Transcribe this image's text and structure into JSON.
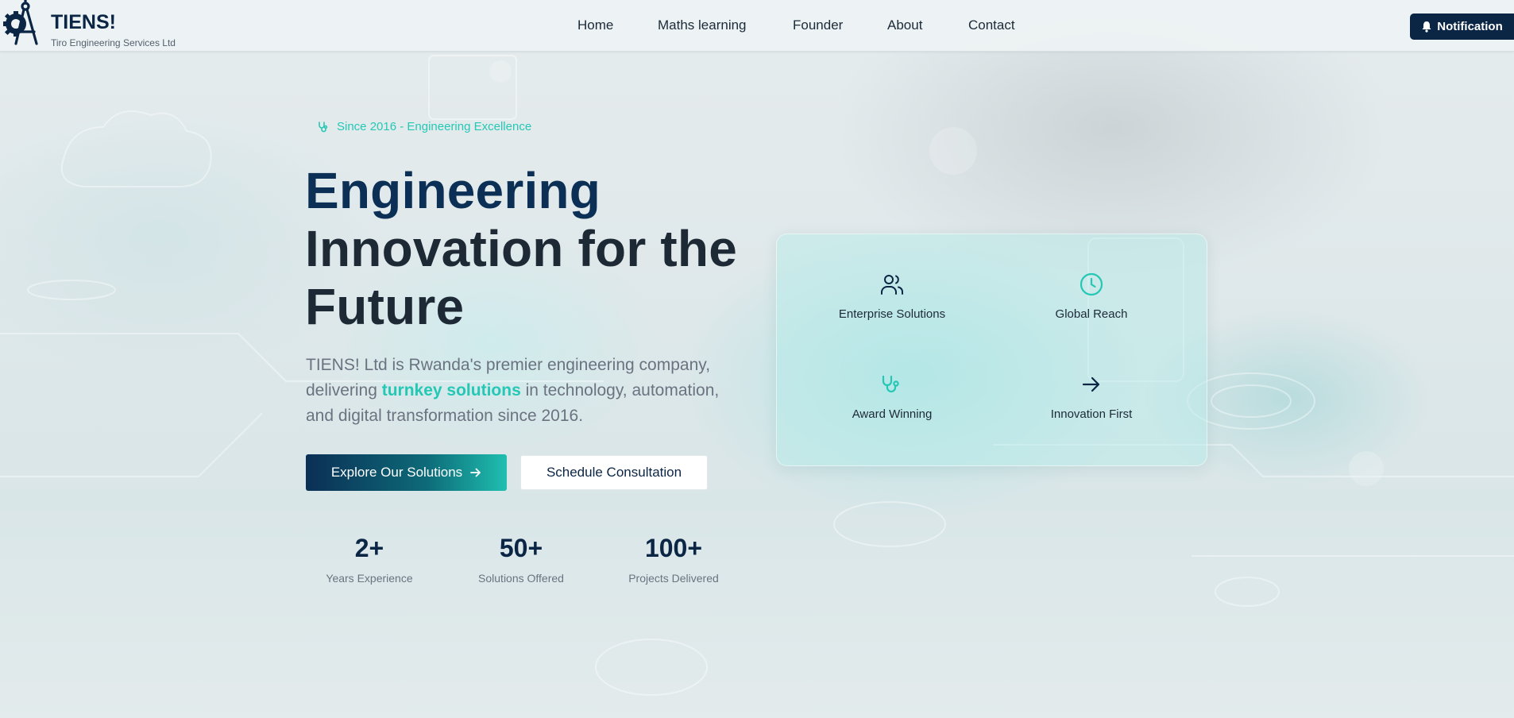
{
  "header": {
    "brand_name": "TIENS!",
    "brand_sub": "Tiro Engineering Services Ltd",
    "nav": [
      "Home",
      "Maths learning",
      "Founder",
      "About",
      "Contact"
    ],
    "notification_label": "Notification"
  },
  "hero": {
    "badge": "Since 2016 - Engineering Excellence",
    "title_lines": [
      "Engineering",
      "Innovation for the",
      "Future"
    ],
    "desc_before": "TIENS! Ltd is Rwanda's premier engineering company, delivering ",
    "desc_highlight": "turnkey solutions",
    "desc_after": " in technology, automation, and digital transformation since 2016.",
    "primary_button": "Explore Our Solutions",
    "secondary_button": "Schedule Consultation"
  },
  "stats": [
    {
      "value": "2+",
      "label": "Years Experience"
    },
    {
      "value": "50+",
      "label": "Solutions Offered"
    },
    {
      "value": "100+",
      "label": "Projects Delivered"
    }
  ],
  "features": [
    {
      "label": "Enterprise Solutions",
      "icon": "users-icon"
    },
    {
      "label": "Global Reach",
      "icon": "clock-icon"
    },
    {
      "label": "Award Winning",
      "icon": "stethoscope-icon"
    },
    {
      "label": "Innovation First",
      "icon": "arrow-right-icon"
    }
  ],
  "colors": {
    "brand_navy": "#0b2545",
    "accent_teal": "#25c7b5",
    "text_muted": "#6b7280"
  }
}
